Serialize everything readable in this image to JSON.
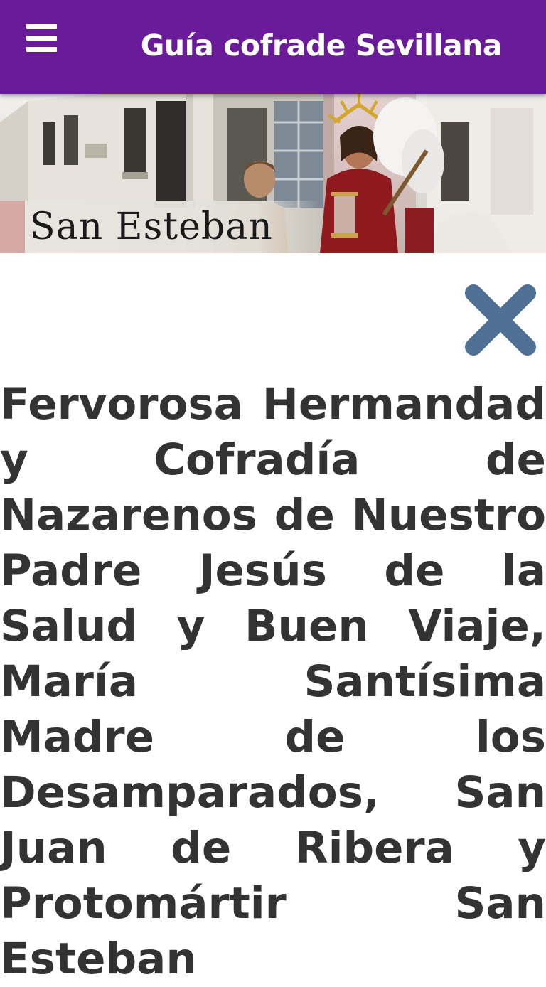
{
  "app_bar": {
    "title": "Guía cofrade Sevillana",
    "menu_icon": "hamburger-menu-icon",
    "background": "#6a1b9a"
  },
  "banner": {
    "label": "San Esteban"
  },
  "close_icon": "close-icon",
  "close_color": "#4f6f94",
  "brotherhood": {
    "name": "Fervorosa Hermandad y Cofradía de Nazarenos de Nuestro Padre Jesús de la Salud y Buen Viaje, María Santísima Madre de los Desamparados, San Juan de Ribera y Protomártir San Esteban"
  }
}
